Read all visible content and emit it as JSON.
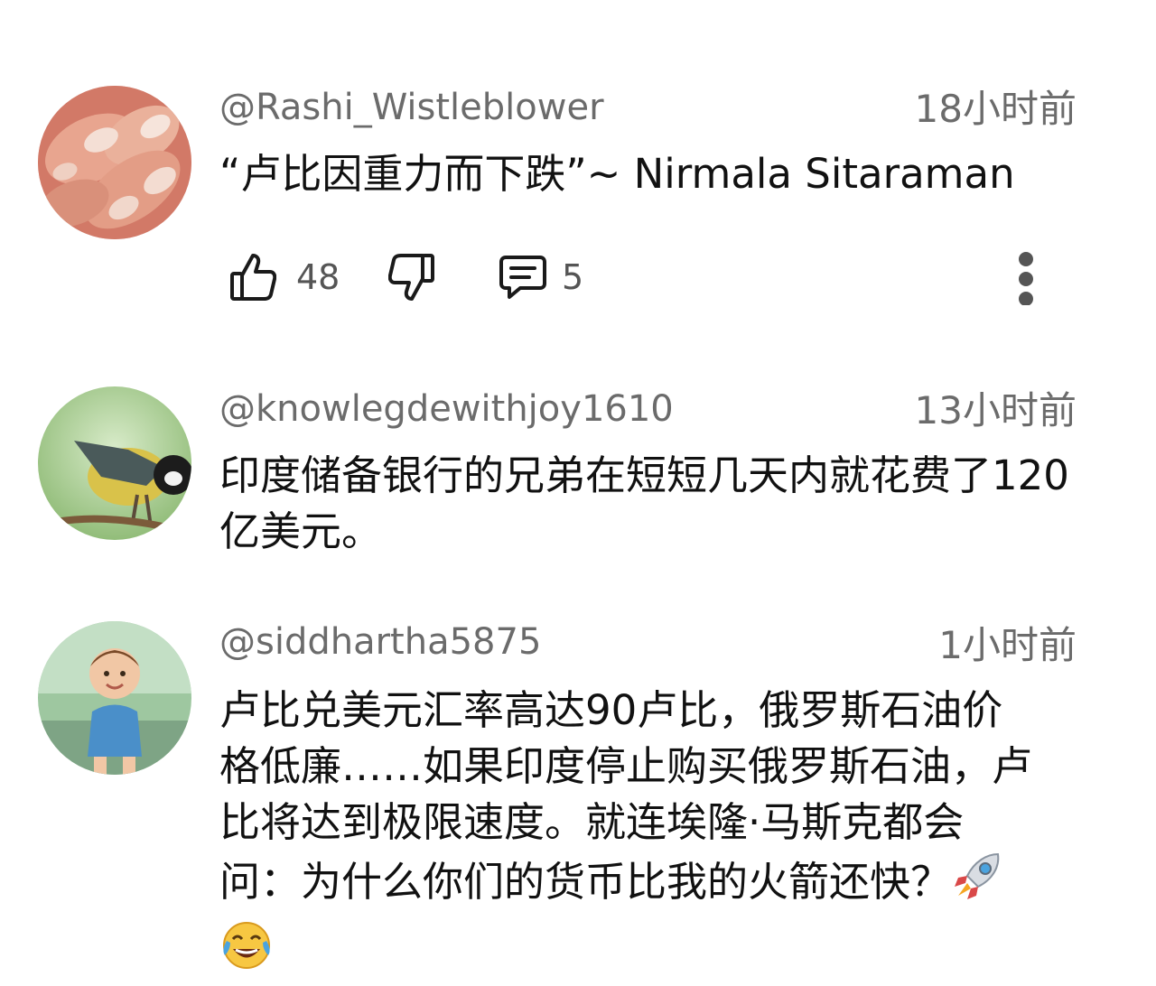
{
  "comments": [
    {
      "handle": "@Rashi_Wistleblower",
      "time": "18小时前",
      "text": "“卢比因重力而下跌”~ Nirmala Sitaraman",
      "likes": "48",
      "replies": "5"
    },
    {
      "handle": "@knowlegdewithjoy1610",
      "time": "13小时前",
      "text": "印度储备银行的兄弟在短短几天内就花费了120亿美元。"
    },
    {
      "handle": "@siddhartha5875",
      "time": "1小时前",
      "text_line1": "卢比兑美元汇率高达90卢比，俄罗斯石油价",
      "text_line2": "格低廉……如果印度停止购买俄罗斯石油，卢",
      "text_line3": "比将达到极限速度。就连埃隆·马斯克都会",
      "text_line4": "问：为什么你们的货币比我的火箭还快？"
    }
  ],
  "icons": {
    "like": "thumbs-up-icon",
    "dislike": "thumbs-down-icon",
    "reply": "comment-icon",
    "more": "more-vertical-icon",
    "rocket": "rocket-emoji",
    "laugh": "tears-of-joy-emoji"
  }
}
